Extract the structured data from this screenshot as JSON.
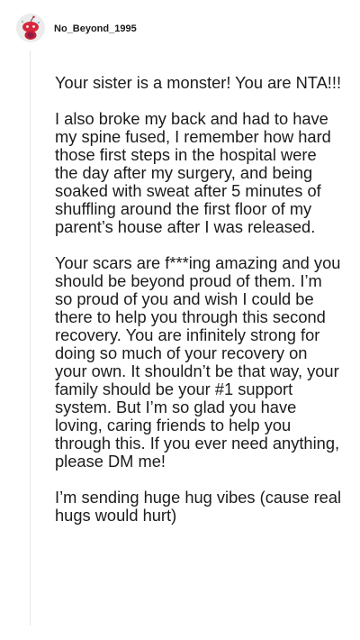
{
  "comment": {
    "username": "No_Beyond_1995",
    "avatar_icon": "snoo-avatar-icon",
    "accent_color": "#d9273e",
    "paragraphs": [
      "Your sister is a monster! You are NTA!!!",
      "I also broke my back and had to have my spine fused, I remember how hard those first steps in the hospital were the day after my surgery, and being soaked with sweat after 5 minutes of shuffling around the first floor of my parent’s house after I was released.",
      "Your scars are f***ing amazing and you should be beyond proud of them. I’m so proud of you and wish I could be there to help you through this second recovery. You are infinitely strong for doing so much of your recovery on your own. It shouldn’t be that way, your family should be your #1 support system. But I’m so glad you have loving, caring friends to help you through this. If you ever need anything, please DM me!",
      "I’m sending huge hug vibes (cause real hugs would hurt)"
    ]
  }
}
